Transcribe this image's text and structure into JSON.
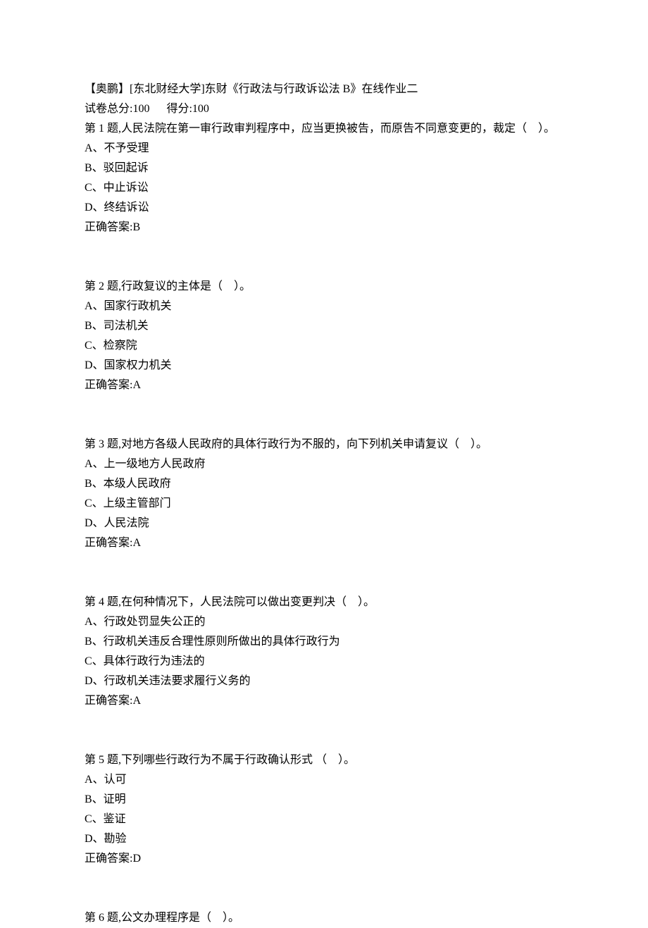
{
  "header": {
    "title_line": "【奥鹏】[东北财经大学]东财《行政法与行政诉讼法 B》在线作业二",
    "score_line": "试卷总分:100      得分:100"
  },
  "questions": [
    {
      "stem": "第 1 题,人民法院在第一审行政审判程序中，应当更换被告，而原告不同意变更的，裁定（    ）。",
      "options": [
        "A、不予受理",
        "B、驳回起诉",
        "C、中止诉讼",
        "D、终结诉讼"
      ],
      "answer": "正确答案:B"
    },
    {
      "stem": "第 2 题,行政复议的主体是（    ）。",
      "options": [
        "A、国家行政机关",
        "B、司法机关",
        "C、检察院",
        "D、国家权力机关"
      ],
      "answer": "正确答案:A"
    },
    {
      "stem": "第 3 题,对地方各级人民政府的具体行政行为不服的，向下列机关申请复议（    ）。",
      "options": [
        "A、上一级地方人民政府",
        "B、本级人民政府",
        "C、上级主管部门",
        "D、人民法院"
      ],
      "answer": "正确答案:A"
    },
    {
      "stem": "第 4 题,在何种情况下，人民法院可以做出变更判决（    ）。",
      "options": [
        "A、行政处罚显失公正的",
        "B、行政机关违反合理性原则所做出的具体行政行为",
        "C、具体行政行为违法的",
        "D、行政机关违法要求履行义务的"
      ],
      "answer": "正确答案:A"
    },
    {
      "stem": "第 5 题,下列哪些行政行为不属于行政确认形式 （    ）。",
      "options": [
        "A、认可",
        "B、证明",
        "C、鉴证",
        "D、勘验"
      ],
      "answer": "正确答案:D"
    },
    {
      "stem": "第 6 题,公文办理程序是（    ）。",
      "options": [],
      "answer": ""
    }
  ]
}
